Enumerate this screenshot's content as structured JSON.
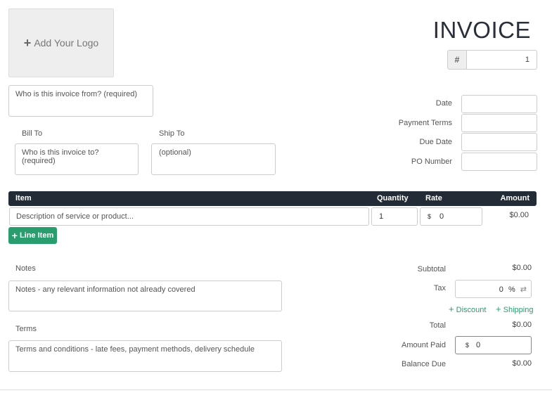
{
  "logo": {
    "label": "Add Your Logo"
  },
  "header": {
    "title": "INVOICE",
    "number_prefix": "#",
    "number_value": "1"
  },
  "from": {
    "placeholder": "Who is this invoice from? (required)"
  },
  "bill_to": {
    "label": "Bill To",
    "placeholder": "Who is this invoice to? (required)"
  },
  "ship_to": {
    "label": "Ship To",
    "placeholder": "(optional)"
  },
  "meta": {
    "date_label": "Date",
    "payment_terms_label": "Payment Terms",
    "due_date_label": "Due Date",
    "po_number_label": "PO Number"
  },
  "table": {
    "headers": {
      "item": "Item",
      "quantity": "Quantity",
      "rate": "Rate",
      "amount": "Amount"
    },
    "rows": [
      {
        "description": "Description of service or product...",
        "quantity": "1",
        "currency": "$",
        "rate": "0",
        "amount": "$0.00"
      }
    ],
    "add_line_label": "Line Item"
  },
  "notes": {
    "label": "Notes",
    "placeholder": "Notes - any relevant information not already covered"
  },
  "terms": {
    "label": "Terms",
    "placeholder": "Terms and conditions - late fees, payment methods, delivery schedule"
  },
  "totals": {
    "subtotal_label": "Subtotal",
    "subtotal_value": "$0.00",
    "tax_label": "Tax",
    "tax_value": "0",
    "tax_unit": "%",
    "discount_label": "Discount",
    "shipping_label": "Shipping",
    "total_label": "Total",
    "total_value": "$0.00",
    "amount_paid_label": "Amount Paid",
    "amount_paid_currency": "$",
    "amount_paid_value": "0",
    "balance_due_label": "Balance Due",
    "balance_due_value": "$0.00"
  },
  "colors": {
    "accent": "#2a9d6e",
    "header_bg": "#232b36"
  }
}
